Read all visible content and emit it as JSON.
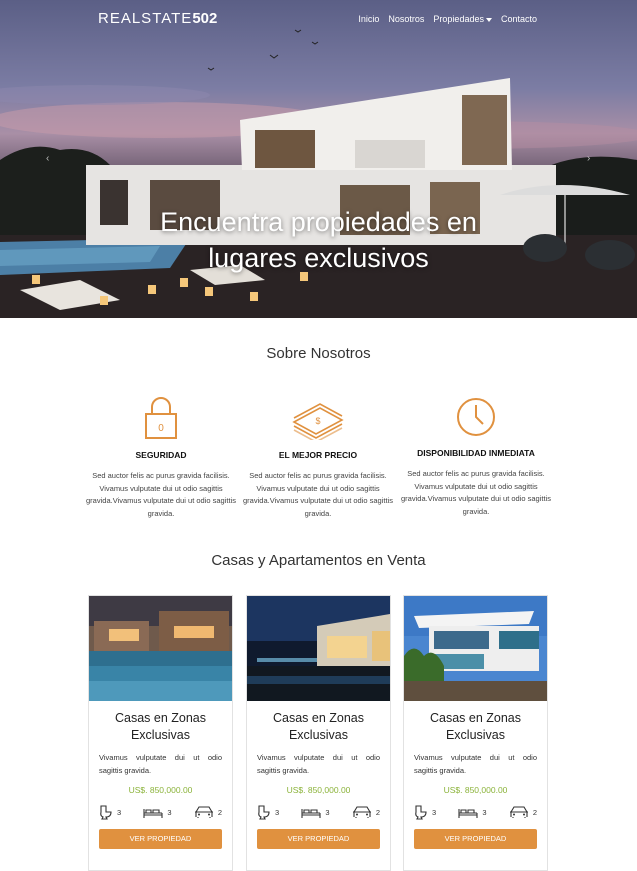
{
  "brand": {
    "prefix": "REALSTATE",
    "suffix": "502"
  },
  "nav": {
    "items": [
      "Inicio",
      "Nosotros",
      "Propiedades",
      "Contacto"
    ]
  },
  "hero": {
    "title_line1": "Encuentra propiedades en",
    "title_line2": "lugares exclusivos"
  },
  "about": {
    "title": "Sobre Nosotros",
    "features": [
      {
        "icon": "lock-icon",
        "title": "SEGURIDAD",
        "text": "Sed auctor felis ac purus gravida facilisis. Vivamus vulputate dui ut odio sagittis gravida.Vivamus vulputate dui ut odio sagittis gravida."
      },
      {
        "icon": "money-stack-icon",
        "title": "EL MEJOR PRECIO",
        "text": "Sed auctor felis ac purus gravida facilisis. Vivamus vulputate dui ut odio sagittis gravida.Vivamus vulputate dui ut odio sagittis gravida."
      },
      {
        "icon": "clock-icon",
        "title": "DISPONIBILIDAD INMEDIATA",
        "text": "Sed auctor felis ac purus gravida facilisis. Vivamus vulputate dui ut odio sagittis gravida.Vivamus vulputate dui ut odio sagittis gravida."
      }
    ]
  },
  "listings": {
    "title": "Casas y Apartamentos en Venta",
    "cards": [
      {
        "title": "Casas en Zonas Exclusivas",
        "text": "Vivamus vulputate dui ut odio sagittis gravida.",
        "price": "US$. 850,000.00",
        "baths": "3",
        "beds": "3",
        "parking": "2",
        "button": "VER PROPIEDAD"
      },
      {
        "title": "Casas en Zonas Exclusivas",
        "text": "Vivamus vulputate dui ut odio sagittis gravida.",
        "price": "US$. 850,000.00",
        "baths": "3",
        "beds": "3",
        "parking": "2",
        "button": "VER PROPIEDAD"
      },
      {
        "title": "Casas en Zonas Exclusivas",
        "text": "Vivamus vulputate dui ut odio sagittis gravida.",
        "price": "US$. 850,000.00",
        "baths": "3",
        "beds": "3",
        "parking": "2",
        "button": "VER PROPIEDAD"
      }
    ]
  },
  "colors": {
    "accent": "#e0913f",
    "price": "#8bb33a"
  }
}
